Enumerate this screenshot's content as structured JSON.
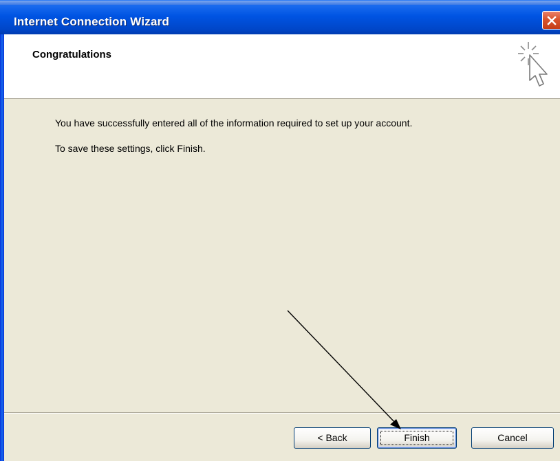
{
  "window": {
    "title": "Internet Connection Wizard",
    "title_bar_color": "#0054E3",
    "close_color": "#D8542E"
  },
  "header": {
    "heading": "Congratulations"
  },
  "content": {
    "line1": "You have successfully entered all of the information required to set up your account.",
    "line2": "To save these settings, click Finish."
  },
  "buttons": {
    "back_label": "< Back",
    "finish_label": "Finish",
    "cancel_label": "Cancel"
  },
  "icons": {
    "close": "close-icon",
    "wizard": "wizard-cursor-icon",
    "annotation": "annotation-arrow"
  }
}
